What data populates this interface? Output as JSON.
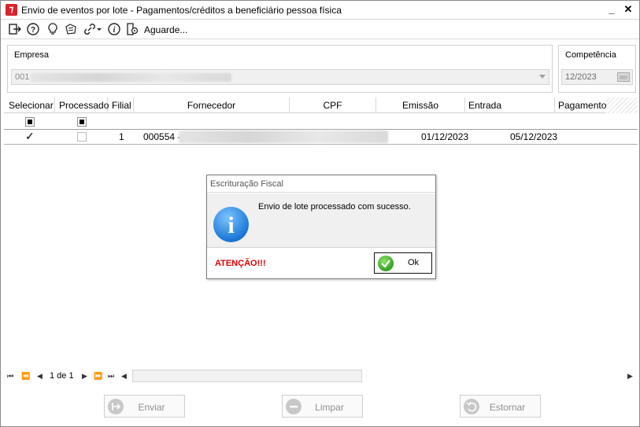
{
  "window": {
    "title": "Envio de eventos por lote - Pagamentos/créditos a beneficiário pessoa física",
    "minimize": "_",
    "close": "✕"
  },
  "toolbar": {
    "icons": [
      "exit-icon",
      "help-icon",
      "lightbulb-icon",
      "clipboard-icon",
      "link-icon",
      "info-icon",
      "settings-doc-icon"
    ],
    "status_label": "Aguarde..."
  },
  "empresa": {
    "label": "Empresa",
    "value_prefix": "001",
    "disabled": true
  },
  "competencia": {
    "label": "Competência",
    "value": "12/2023"
  },
  "grid": {
    "columns": [
      "Selecionar",
      "Processado",
      "Filial",
      "Fornecedor",
      "CPF",
      "Emissão",
      "Entrada",
      "Pagamento"
    ],
    "rows": [
      {
        "selecionar": "✓",
        "processado": false,
        "filial": "1",
        "fornecedor": "000554 -",
        "cpf": "",
        "emissao": "01/12/2023",
        "entrada": "05/12/2023",
        "pagamento": ""
      }
    ]
  },
  "pager": {
    "page_text": "1 de 1"
  },
  "buttons": {
    "enviar": "Enviar",
    "limpar": "Limpar",
    "estornar": "Estornar"
  },
  "dialog": {
    "title": "Escrituração Fiscal",
    "message": "Envio de lote processado com sucesso.",
    "warning": "ATENÇÃO!!!",
    "ok_label": "Ok",
    "icon_letter": "i"
  },
  "colors": {
    "accent_red": "#d8232a",
    "warning_red": "#e00000",
    "info_blue": "#1c78d6",
    "ok_green": "#2e9a1f"
  }
}
